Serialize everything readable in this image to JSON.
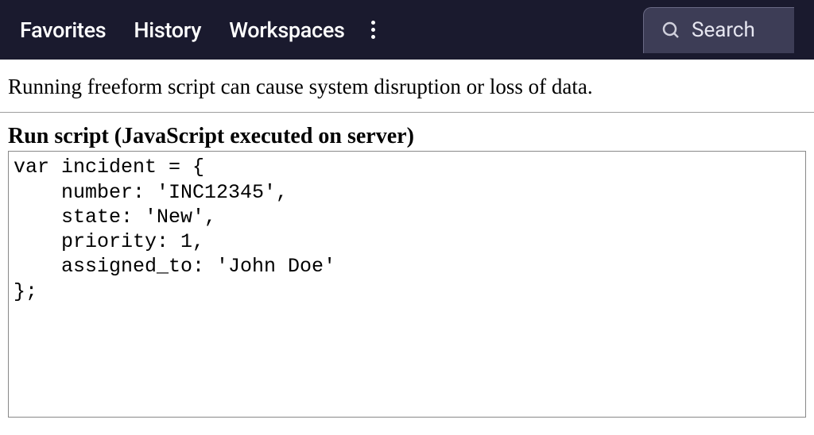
{
  "nav": {
    "items": [
      {
        "label": "Favorites"
      },
      {
        "label": "History"
      },
      {
        "label": "Workspaces"
      }
    ],
    "search_label": "Search"
  },
  "warning": {
    "text": "Running freeform script can cause system disruption or loss of data."
  },
  "script_panel": {
    "heading": "Run script (JavaScript executed on server)",
    "code": "var incident = {\n    number: 'INC12345',\n    state: 'New',\n    priority: 1,\n    assigned_to: 'John Doe'\n};"
  }
}
